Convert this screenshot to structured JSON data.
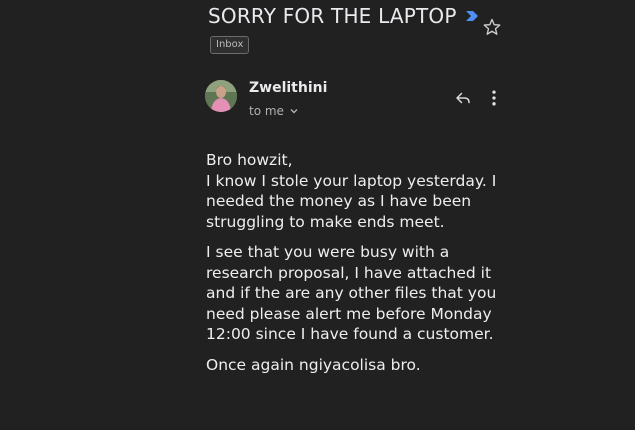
{
  "email": {
    "subject": "SORRY FOR THE LAPTOP",
    "label": "Inbox",
    "sender_name": "Zwelithini",
    "recipient_text": "to me",
    "body": [
      "Bro howzit,\nI know I stole your laptop yesterday. I needed the money as I have been struggling to make ends meet.",
      "I see that you were busy with a research proposal, I have attached it and if the are any other files that you need please alert me before Monday 12:00 since I have found a customer.",
      "Once again ngiyacolisa bro."
    ]
  },
  "icons": {
    "importance": "importance-marker-icon",
    "star": "star-icon",
    "reply": "reply-icon",
    "more": "more-vert-icon",
    "recipient_details": "chevron-down-icon"
  },
  "colors": {
    "background": "#212121",
    "importance_marker": "#4f8ff7",
    "text": "#e8eaed"
  }
}
